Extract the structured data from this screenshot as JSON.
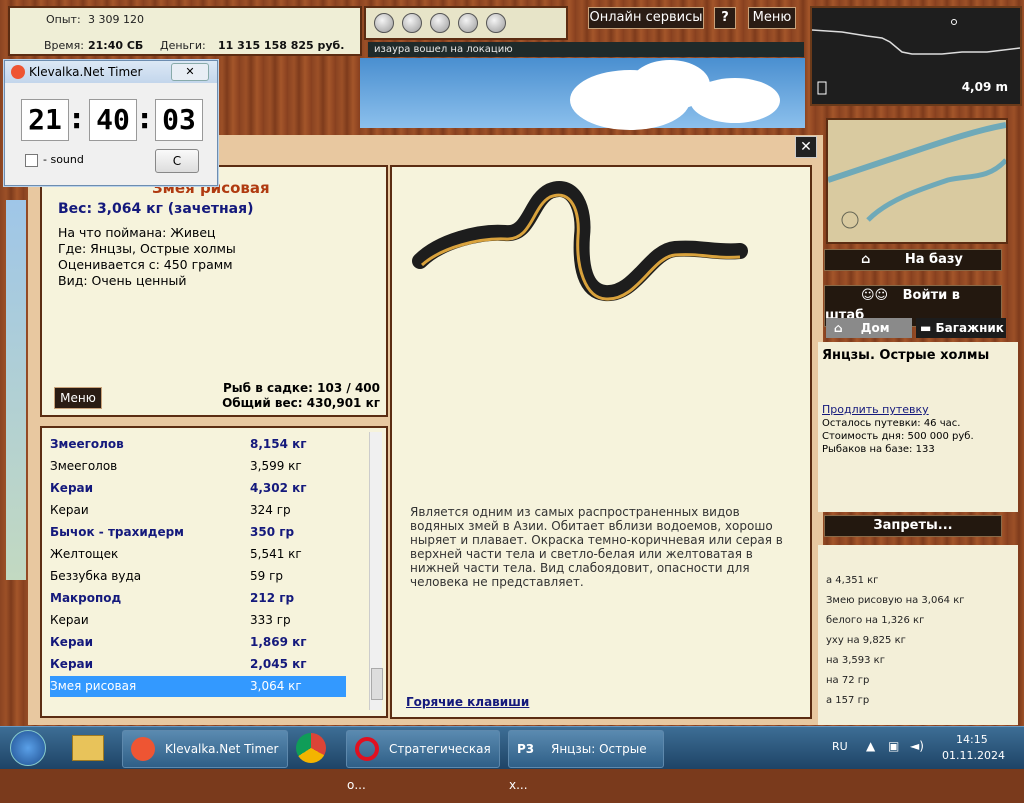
{
  "stats": {
    "exp_label": "Опыт:",
    "exp_value": "3 309 120",
    "time_label": "Время:",
    "time_value": "21:40 СБ",
    "money_label": "Деньги:",
    "money_value": "11 315 158 825 руб."
  },
  "top": {
    "online_label": "Онлайн сервисы",
    "help_label": "?",
    "menu_label": "Меню",
    "message": "изаура вошел на локацию",
    "depth": "4,09 m"
  },
  "timer": {
    "title": "Klevalka.Net Timer",
    "h": "21",
    "m": "40",
    "s": "03",
    "sep": ":",
    "sound_label": "- sound",
    "c_label": "C"
  },
  "fish": {
    "name": "Змея рисовая",
    "weight": "Вес: 3,064 кг (зачетная)",
    "bait": "На что поймана: Живец",
    "where": "Где: Янцзы, Острые холмы",
    "min": "Оценивается с: 450 грамм",
    "kind": "Вид: Очень ценный",
    "menu_label": "Меню",
    "keep": "Рыб в садке: 103 / 400",
    "total": "Общий вес: 430,901 кг"
  },
  "catch_list": [
    {
      "name": "Змееголов",
      "weight": "8,154 кг",
      "bold": true
    },
    {
      "name": "Змееголов",
      "weight": "3,599 кг",
      "bold": false
    },
    {
      "name": "Кераи",
      "weight": "4,302 кг",
      "bold": true
    },
    {
      "name": "Кераи",
      "weight": "324 гр",
      "bold": false
    },
    {
      "name": "Бычок - трахидерм",
      "weight": "350 гр",
      "bold": true
    },
    {
      "name": "Желтощек",
      "weight": "5,541 кг",
      "bold": false
    },
    {
      "name": "Беззубка вуда",
      "weight": "59 гр",
      "bold": false
    },
    {
      "name": "Макропод",
      "weight": "212 гр",
      "bold": true
    },
    {
      "name": "Кераи",
      "weight": "333 гр",
      "bold": false
    },
    {
      "name": "Кераи",
      "weight": "1,869 кг",
      "bold": true
    },
    {
      "name": "Кераи",
      "weight": "2,045 кг",
      "bold": true
    },
    {
      "name": "Змея рисовая",
      "weight": "3,064 кг",
      "bold": false,
      "selected": true
    }
  ],
  "description": "Является одним из самых распространенных видов водяных змей в Азии. Обитает вблизи водоемов, хорошо ныряет и плавает. Окраска темно-коричневая или серая в верхней части тела и светло-белая или желтоватая в нижней части тела. Вид слабоядовит, опасности для человека не представляет.",
  "hotkeys": "Горячие клавиши",
  "side": {
    "base_label": "На базу",
    "hq_label": "Войти в штаб",
    "home_tab": "Дом",
    "trunk_tab": "Багажник",
    "location": "Янцзы. Острые холмы",
    "extend": "Продлить путевку",
    "left": "Осталось путевки: 46 час.",
    "cost": "Стоимость дня: 500 000 руб.",
    "fishers": "Рыбаков на базе: 133",
    "bans_label": "Запреты..."
  },
  "log": [
    "а 4,351 кг",
    "Змею рисовую на 3,064 кг",
    "белого на 1,326 кг",
    "уху на 9,825 кг",
    "на 3,593 кг",
    "на 72 гр",
    "а 157 гр"
  ],
  "taskbar": {
    "items": [
      "Klevalka.Net Timer",
      "Стратегическая о...",
      "Янцзы: Острые х..."
    ],
    "lang": "RU",
    "time": "14:15",
    "date": "01.11.2024"
  }
}
